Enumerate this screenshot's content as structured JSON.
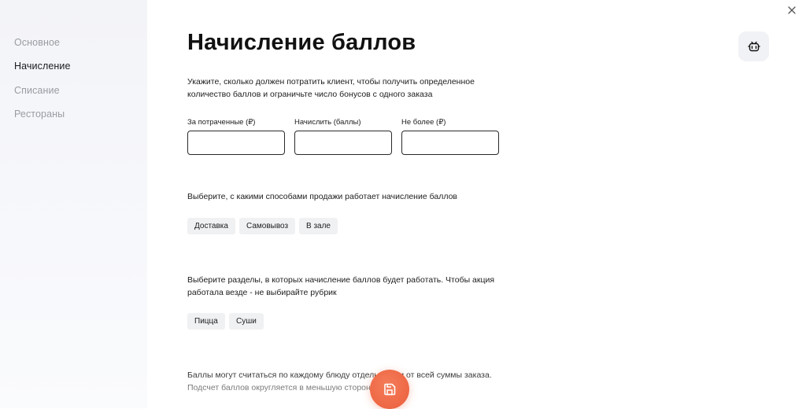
{
  "sidebar": {
    "items": [
      {
        "label": "Основное"
      },
      {
        "label": "Начисление"
      },
      {
        "label": "Списание"
      },
      {
        "label": "Рестораны"
      }
    ]
  },
  "page": {
    "title": "Начисление баллов",
    "intro_line1": "Укажите, сколько должен потратить клиент, чтобы получить определенное",
    "intro_line2": "количество баллов и ограничьте число бонусов с одного заказа"
  },
  "fields": {
    "spent_label": "За потраченные (₽)",
    "spent_value": "",
    "accrue_label": "Начислить (баллы)",
    "accrue_value": "",
    "max_label": "Не более (₽)",
    "max_value": ""
  },
  "sales_methods": {
    "prompt": "Выберите, с какими способами продажи работает начисление баллов",
    "options": [
      "Доставка",
      "Самовывоз",
      "В зале"
    ]
  },
  "sections": {
    "prompt_line1": "Выберите разделы, в которых начисление баллов будет работать. Чтобы акция",
    "prompt_line2": "работала везде - не выбирайте рубрик",
    "options": [
      "Пицца",
      "Суши"
    ]
  },
  "calc_note": {
    "line1": "Баллы могут считаться по каждому блюду отдельно или от всей суммы заказа.",
    "line2": "Подсчет баллов округляется в меньшую сторону"
  },
  "icons": {
    "close": "close-icon",
    "robot": "robot-icon",
    "save": "save-icon"
  },
  "colors": {
    "accent": "#ef6a47",
    "chip_bg": "#f0f1f3",
    "sidebar_bg": "#f4f5f8"
  }
}
